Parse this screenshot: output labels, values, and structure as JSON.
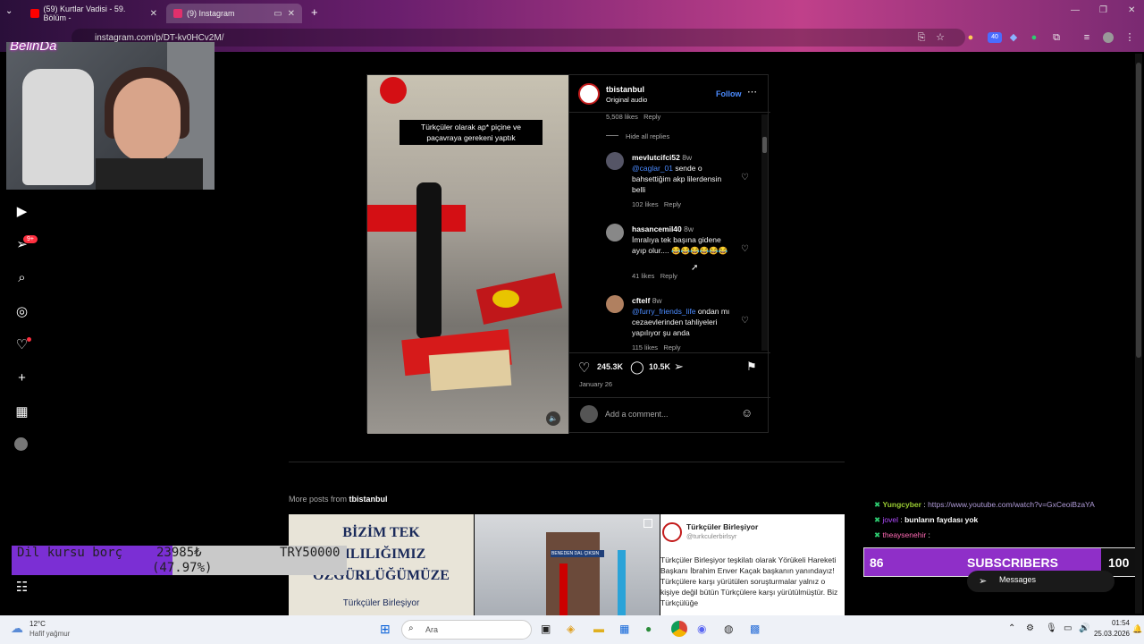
{
  "browser": {
    "tabs": [
      {
        "label": "(59) Kurtlar Vadisi - 59. Bölüm -",
        "favicon_color": "#ff0000"
      },
      {
        "label": "(9) Instagram",
        "favicon_color": "#e1306c"
      }
    ],
    "url": "instagram.com/p/DT-kv0HCv2M/",
    "ext_badge": "40"
  },
  "stream": {
    "logo_text": "BelinDa"
  },
  "sidebar": {
    "notification_badge": "9+",
    "items": [
      "reels-icon",
      "messages-icon",
      "search-icon",
      "explore-icon",
      "heart-icon",
      "create-icon",
      "dashboard-icon",
      "profile-icon",
      "more-icon"
    ]
  },
  "post": {
    "video_caption": "Türkçüler olarak ap* piçine ve paçavraya gerekeni yaptık",
    "username": "tbistanbul",
    "audio": "Original audio",
    "follow_label": "Follow",
    "prev_meta": {
      "likes": "5,508 likes",
      "reply": "Reply"
    },
    "hide_replies": "Hide all replies",
    "comments": [
      {
        "user": "mevlutcifci52",
        "time": "8w",
        "mention": "@caglar_01",
        "text": " sende o bahsettiğim akp lilerdensin belli",
        "likes": "102 likes",
        "reply": "Reply"
      },
      {
        "user": "hasancemil40",
        "time": "8w",
        "mention": "",
        "text": "İmralıya tek başına gidene ayıp olur.... 😂😂😂😂😂😂",
        "likes": "41 likes",
        "reply": "Reply"
      },
      {
        "user": "cftelf",
        "time": "8w",
        "mention": "@furry_friends_life",
        "text": " ondan mı cezaevlerinden tahliyeleri yapılıyor şu anda",
        "likes": "115 likes",
        "reply": "Reply"
      }
    ],
    "like_count": "245.3K",
    "comment_count": "10.5K",
    "date": "January 26",
    "add_comment_placeholder": "Add a comment..."
  },
  "more_posts": {
    "label": "More posts from ",
    "user": "tbistanbul",
    "thumb1_text": [
      "BİZİM TEK",
      "MLILIĞIMIZ",
      "ÖZGÜRLÜĞÜMÜZE",
      "Türkçüler Birleşiyor"
    ],
    "thumb2_sign": "BENEDEN DAL ÇIKSIN",
    "thumb3": {
      "name": "Türkçüler Birleşiyor",
      "handle": "@turkculerbirlsyr",
      "text": "Türkçüler Birleşiyor teşkilatı olarak Yörükeli Hareketi Başkanı İbrahim Enver Kaçak başkanın yanındayız! Türkçülere karşı yürütülen soruşturmalar yalnız o kişiye değil bütün Türkçülere karşı yürütülmüştür. Biz Türkçülüğe"
    }
  },
  "overlays": {
    "goal": {
      "title": "Dil kursu borç",
      "current": "23985₺",
      "percent": "(47.97%)",
      "target": "TRY50000",
      "progress": 0.4797
    },
    "chat": [
      {
        "user": "Yungcyber",
        "user_color": "#9acd32",
        "text": "https://www.youtube.com/watch?v=GxCeoiBzaYA",
        "text_color": "#b19cd9"
      },
      {
        "user": "jovel",
        "user_color": "#b04cff",
        "text": "bunların faydası yok",
        "text_color": "#ffffff"
      },
      {
        "user": "theaysenehir",
        "user_color": "#ff69b4",
        "text": "",
        "text_color": "#ffffff"
      }
    ],
    "subs": {
      "current": "86",
      "label": "SUBSCRIBERS",
      "goal": "100",
      "progress": 0.86
    },
    "messages_label": "Messages"
  },
  "taskbar": {
    "weather_temp": "12°C",
    "weather_desc": "Hafif yağmur",
    "search_placeholder": "Ara",
    "time": "01:54",
    "date": "25.03.2026"
  },
  "colors": {
    "accent_blue": "#4b8bff",
    "goal_purple": "#7b2fd4",
    "subs_purple": "#8f2fc8"
  }
}
